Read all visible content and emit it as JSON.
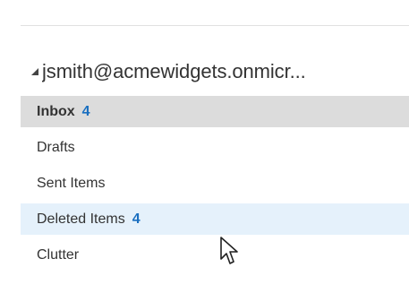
{
  "account": {
    "email": "jsmith@acmewidgets.onmicr...",
    "expanded": true,
    "caret_icon": "collapse-triangle-icon"
  },
  "folders": [
    {
      "label": "Inbox",
      "count": "4",
      "state": "selected"
    },
    {
      "label": "Drafts",
      "count": "",
      "state": "normal"
    },
    {
      "label": "Sent Items",
      "count": "",
      "state": "normal"
    },
    {
      "label": "Deleted Items",
      "count": "4",
      "state": "hover"
    },
    {
      "label": "Clutter",
      "count": "",
      "state": "normal"
    }
  ],
  "colors": {
    "selected_background": "#dcdcdc",
    "hover_background": "#e5f1fb",
    "count_accent": "#1a6fc0",
    "text": "#333333"
  },
  "cursor_icon": "mouse-pointer-icon"
}
